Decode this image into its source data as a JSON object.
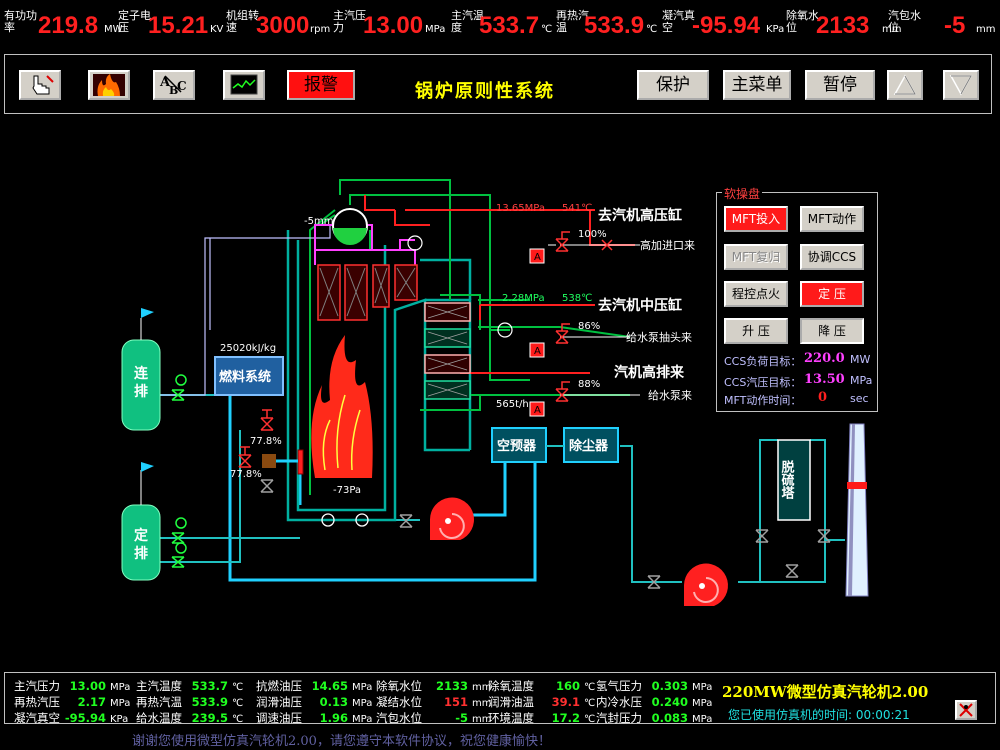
{
  "topbar": {
    "metrics": [
      {
        "label": "有功功率",
        "value": "219.8",
        "unit": "MW"
      },
      {
        "label": "定子电压",
        "value": "15.21",
        "unit": "KV"
      },
      {
        "label": "机组转速",
        "value": "3000",
        "unit": "rpm"
      },
      {
        "label": "主汽压力",
        "value": "13.00",
        "unit": "MPa"
      },
      {
        "label": "主汽温度",
        "value": "533.7",
        "unit": "℃"
      },
      {
        "label": "再热汽温",
        "value": "533.9",
        "unit": "℃"
      },
      {
        "label": "凝汽真空",
        "value": "-95.94",
        "unit": "KPa"
      },
      {
        "label": "除氧水位",
        "value": "2133",
        "unit": "mm"
      },
      {
        "label": "汽包水位",
        "value": "-5",
        "unit": "mm"
      }
    ]
  },
  "toolbar": {
    "alarm_label": "报警",
    "system_title": "锅炉原则性系统",
    "protect_label": "保护",
    "main_menu_label": "主菜单",
    "pause_label": "暂停",
    "icons": [
      "operator-hand-icon",
      "fire-icon",
      "abc-text-icon",
      "trend-monitor-icon",
      "arrow-up-icon",
      "arrow-down-icon"
    ]
  },
  "diagram": {
    "drum_level": "-5mm",
    "main_steam_pressure": "13.65MPa",
    "main_steam_temp": "541℃",
    "to_hp_cylinder": "去汽机高压缸",
    "hp_valve_pct": "100%",
    "hp_heater_inlet": "高加进口来",
    "reheat_pressure": "2.28MPa",
    "reheat_temp": "538℃",
    "to_ip_cylinder": "去汽机中压缸",
    "reheat_spray_pct": "86%",
    "feedwater_tap": "给水泵抽头来",
    "hp_exhaust": "汽机高排来",
    "feedwater_valve_pct": "88%",
    "feedwater_flow": "565t/h",
    "from_feed_pump": "给水泵来",
    "fuel_heat": "25020kJ/kg",
    "fuel_system": "燃料系统",
    "fuel_valve1_pct": "77.8%",
    "fuel_valve2_pct": "77.8%",
    "furnace_pressure": "-73Pa",
    "air_preheater": "空预器",
    "dust_collector": "除尘器",
    "desulfur_tower": "脱硫塔",
    "cont_blowdown": "连排",
    "periodic_blowdown": "定排",
    "auto_tag": "A"
  },
  "panel": {
    "title": "软操盘",
    "mft_on": "MFT投入",
    "mft_act": "MFT动作",
    "mft_reset": "MFT复归",
    "coord_ccs": "协调CCS",
    "prog_ignite": "程控点火",
    "fixed_pressure": "定 压",
    "raise_pressure": "升 压",
    "lower_pressure": "降 压",
    "ccs_load_label": "CCS负荷目标：",
    "ccs_load_value": "220.0",
    "ccs_load_unit": "MW",
    "ccs_press_label": "CCS汽压目标：",
    "ccs_press_value": "13.50",
    "ccs_press_unit": "MPa",
    "mft_time_label": "MFT动作时间：",
    "mft_time_value": "0",
    "mft_time_unit": "sec"
  },
  "bottom": {
    "rows": [
      [
        {
          "label": "主汽压力",
          "value": "13.00",
          "unit": "MPa",
          "red": false
        },
        {
          "label": "主汽温度",
          "value": "533.7",
          "unit": "℃",
          "red": false
        },
        {
          "label": "抗燃油压",
          "value": "14.65",
          "unit": "MPa",
          "red": false
        },
        {
          "label": "除氧水位",
          "value": "2133",
          "unit": "mm",
          "red": false
        },
        {
          "label": "除氧温度",
          "value": "160",
          "unit": "℃",
          "red": false
        },
        {
          "label": "氢气压力",
          "value": "0.303",
          "unit": "MPa",
          "red": false
        }
      ],
      [
        {
          "label": "再热汽压",
          "value": "2.17",
          "unit": "MPa",
          "red": false
        },
        {
          "label": "再热汽温",
          "value": "533.9",
          "unit": "℃",
          "red": false
        },
        {
          "label": "润滑油压",
          "value": "0.13",
          "unit": "MPa",
          "red": false
        },
        {
          "label": "凝结水位",
          "value": "151",
          "unit": "mm",
          "red": true
        },
        {
          "label": "润滑油温",
          "value": "39.1",
          "unit": "℃",
          "red": true
        },
        {
          "label": "内冷水压",
          "value": "0.240",
          "unit": "MPa",
          "red": false
        }
      ],
      [
        {
          "label": "凝汽真空",
          "value": "-95.94",
          "unit": "KPa",
          "red": false
        },
        {
          "label": "给水温度",
          "value": "239.5",
          "unit": "℃",
          "red": false
        },
        {
          "label": "调速油压",
          "value": "1.96",
          "unit": "MPa",
          "red": false
        },
        {
          "label": "汽包水位",
          "value": "-5",
          "unit": "mm",
          "red": false
        },
        {
          "label": "环境温度",
          "value": "17.2",
          "unit": "℃",
          "red": false
        },
        {
          "label": "汽封压力",
          "value": "0.083",
          "unit": "MPa",
          "red": false
        }
      ]
    ],
    "brand": "220MW微型仿真汽轮机2.00",
    "use_time_label": "您已使用仿真机的时间:",
    "use_time_value": "00:00:21"
  },
  "footer": {
    "text": "谢谢您使用微型仿真汽轮机2.00，请您遵守本软件协议，祝您健康愉快！"
  },
  "colors": {
    "value_red": "#ff2020",
    "value_green": "#20ff20",
    "pipe_green": "#00c040",
    "pipe_cyan": "#20d0ff",
    "pipe_red": "#ff2020",
    "flame": "#ff2a1a",
    "accent_yellow": "#ffff00"
  }
}
